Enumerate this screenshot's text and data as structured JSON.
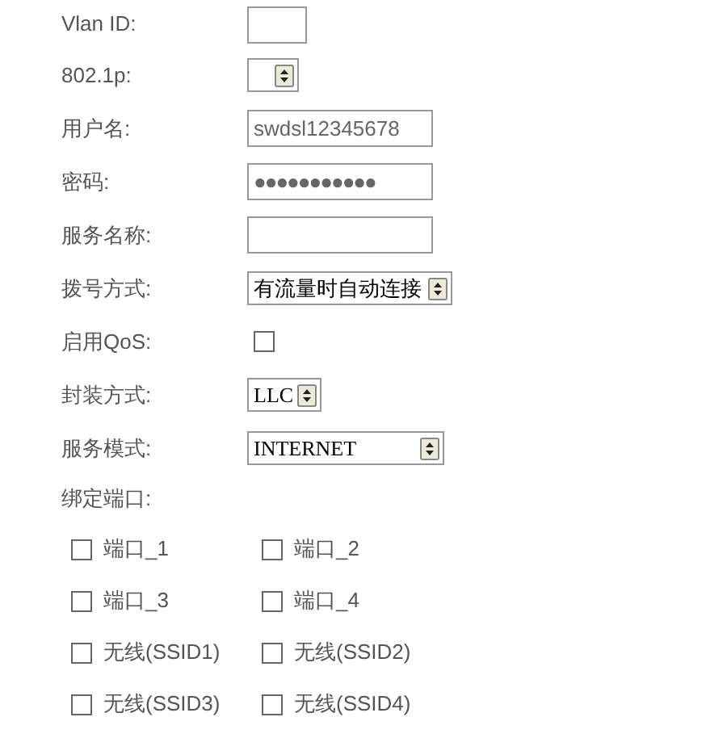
{
  "fields": [
    {
      "label": "Vlan ID:",
      "kind": "text"
    },
    {
      "label": "802.1p:",
      "kind": "select"
    },
    {
      "label": "用户名:",
      "kind": "text",
      "value": "swdsl12345678"
    },
    {
      "label": "密码:",
      "kind": "password",
      "value": "●●●●●●●●●●●"
    },
    {
      "label": "服务名称:",
      "kind": "text"
    },
    {
      "label": "拨号方式:",
      "kind": "select",
      "value": "有流量时自动连接"
    },
    {
      "label": "启用QoS:",
      "kind": "checkbox",
      "checked": false
    },
    {
      "label": "封装方式:",
      "kind": "select",
      "value": "LLC"
    },
    {
      "label": "服务模式:",
      "kind": "select",
      "value": "INTERNET"
    }
  ],
  "bind_ports": {
    "label": "绑定端口:",
    "options": [
      {
        "label": "端口_1",
        "checked": false
      },
      {
        "label": "端口_2",
        "checked": false
      },
      {
        "label": "端口_3",
        "checked": false
      },
      {
        "label": "端口_4",
        "checked": false
      },
      {
        "label": "无线(SSID1)",
        "checked": false
      },
      {
        "label": "无线(SSID2)",
        "checked": false
      },
      {
        "label": "无线(SSID3)",
        "checked": false
      },
      {
        "label": "无线(SSID4)",
        "checked": false
      }
    ]
  }
}
